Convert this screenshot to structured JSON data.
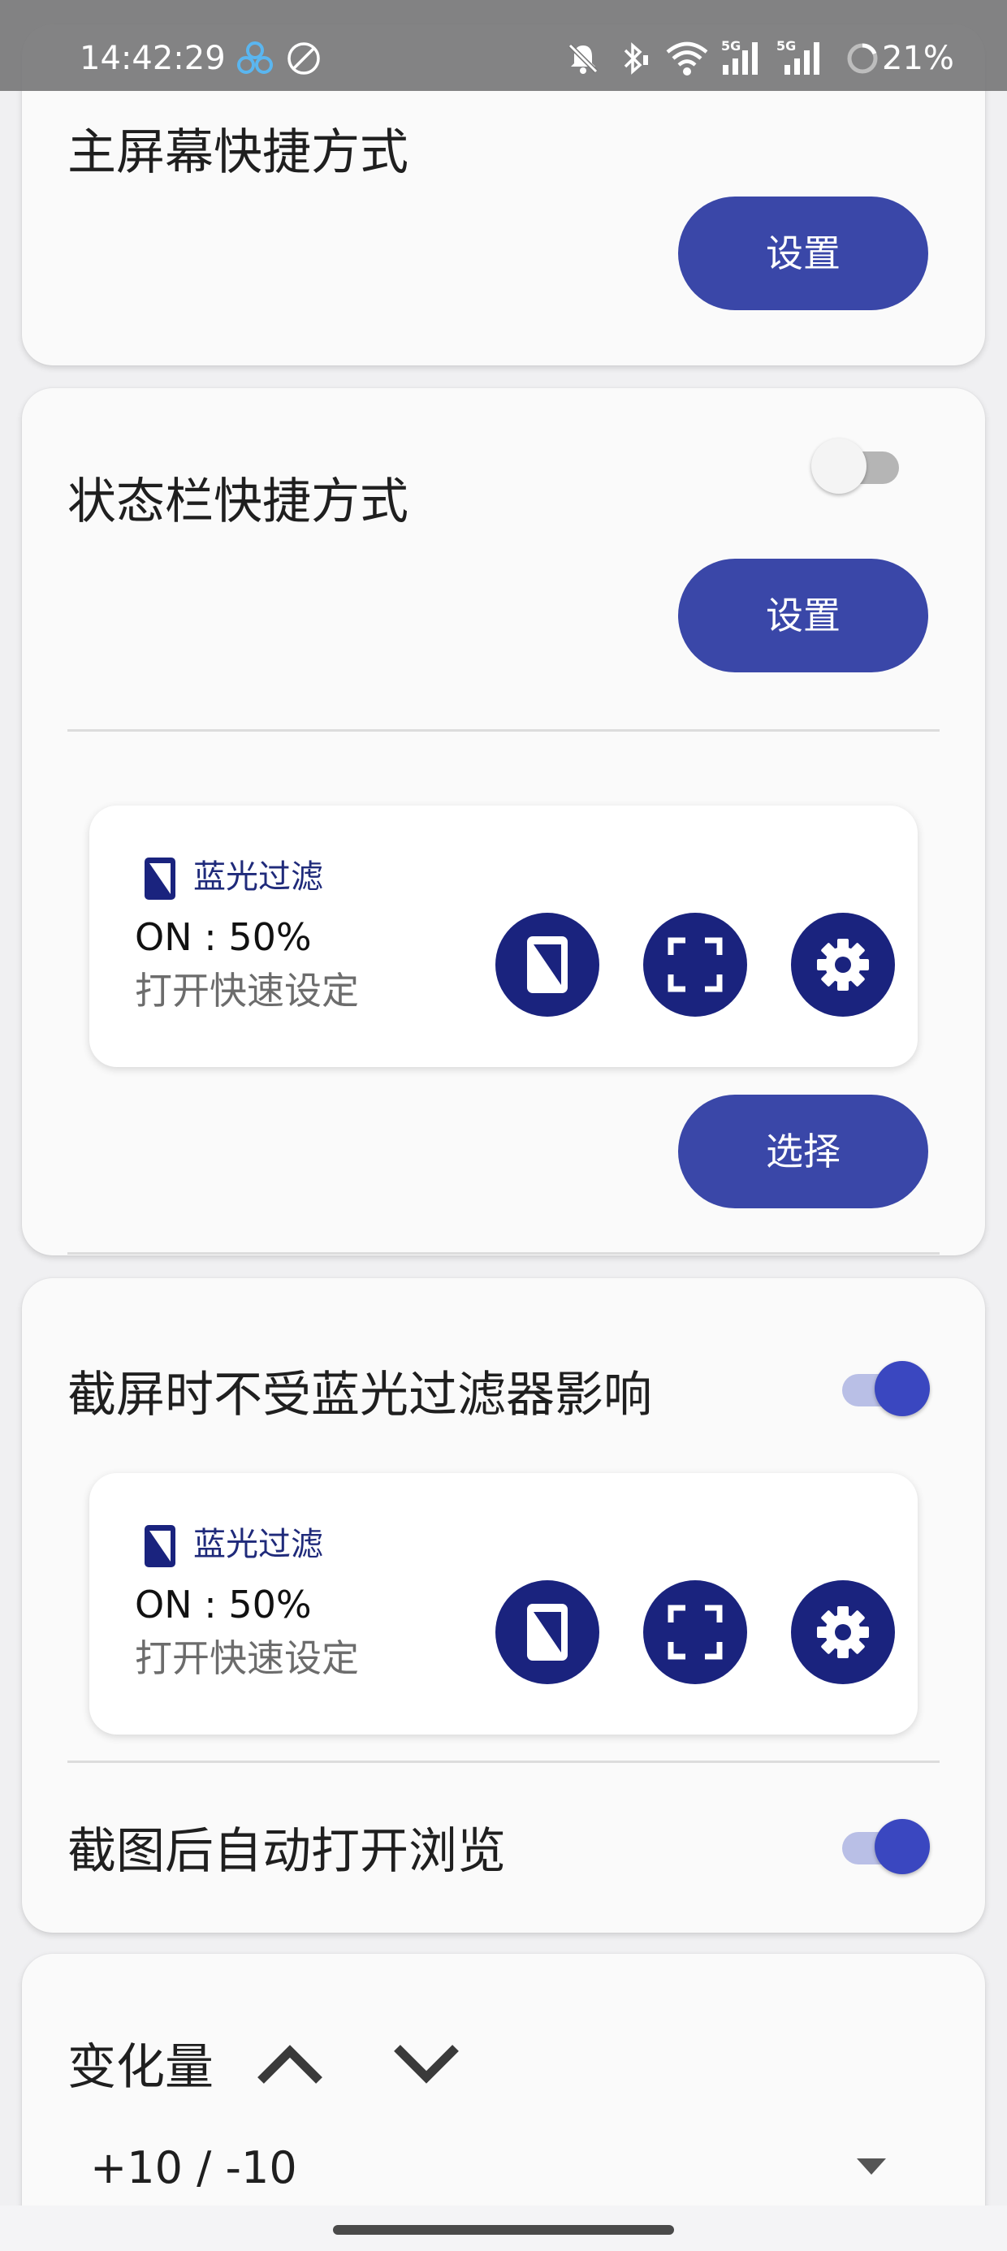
{
  "status_bar": {
    "time": "14:42:29",
    "battery": "21%",
    "network_labels": [
      "5G",
      "5G"
    ],
    "icons": [
      "cloud-sync-icon",
      "no-drawing-icon",
      "mute-icon",
      "bluetooth-icon",
      "wifi-icon",
      "signal-5g-icon",
      "signal-5g-icon-2",
      "battery-ring-icon"
    ]
  },
  "home_shortcut": {
    "title": "主屏幕快捷方式",
    "button_label": "设置"
  },
  "statusbar_shortcut": {
    "title": "状态栏快捷方式",
    "toggle_on": false,
    "button_label": "设置",
    "select_label": "选择"
  },
  "notification_preview": {
    "app_name": "蓝光过滤",
    "state": "ON : 50%",
    "subtitle": "打开快速设定",
    "actions": [
      "phone-filter-icon",
      "screenshot-frame-icon",
      "gear-icon"
    ]
  },
  "screenshot_setting": {
    "title": "截屏时不受蓝光过滤器影响",
    "toggle_on": true
  },
  "auto_open": {
    "title": "截图后自动打开浏览",
    "toggle_on": true
  },
  "change_amount": {
    "title": "变化量",
    "value": "+10 / -10"
  },
  "colors": {
    "accent": "#3a47a8",
    "preview_button": "#1a237e",
    "switch_on": "#3a47c0",
    "switch_track_on": "#b9bfe6"
  }
}
